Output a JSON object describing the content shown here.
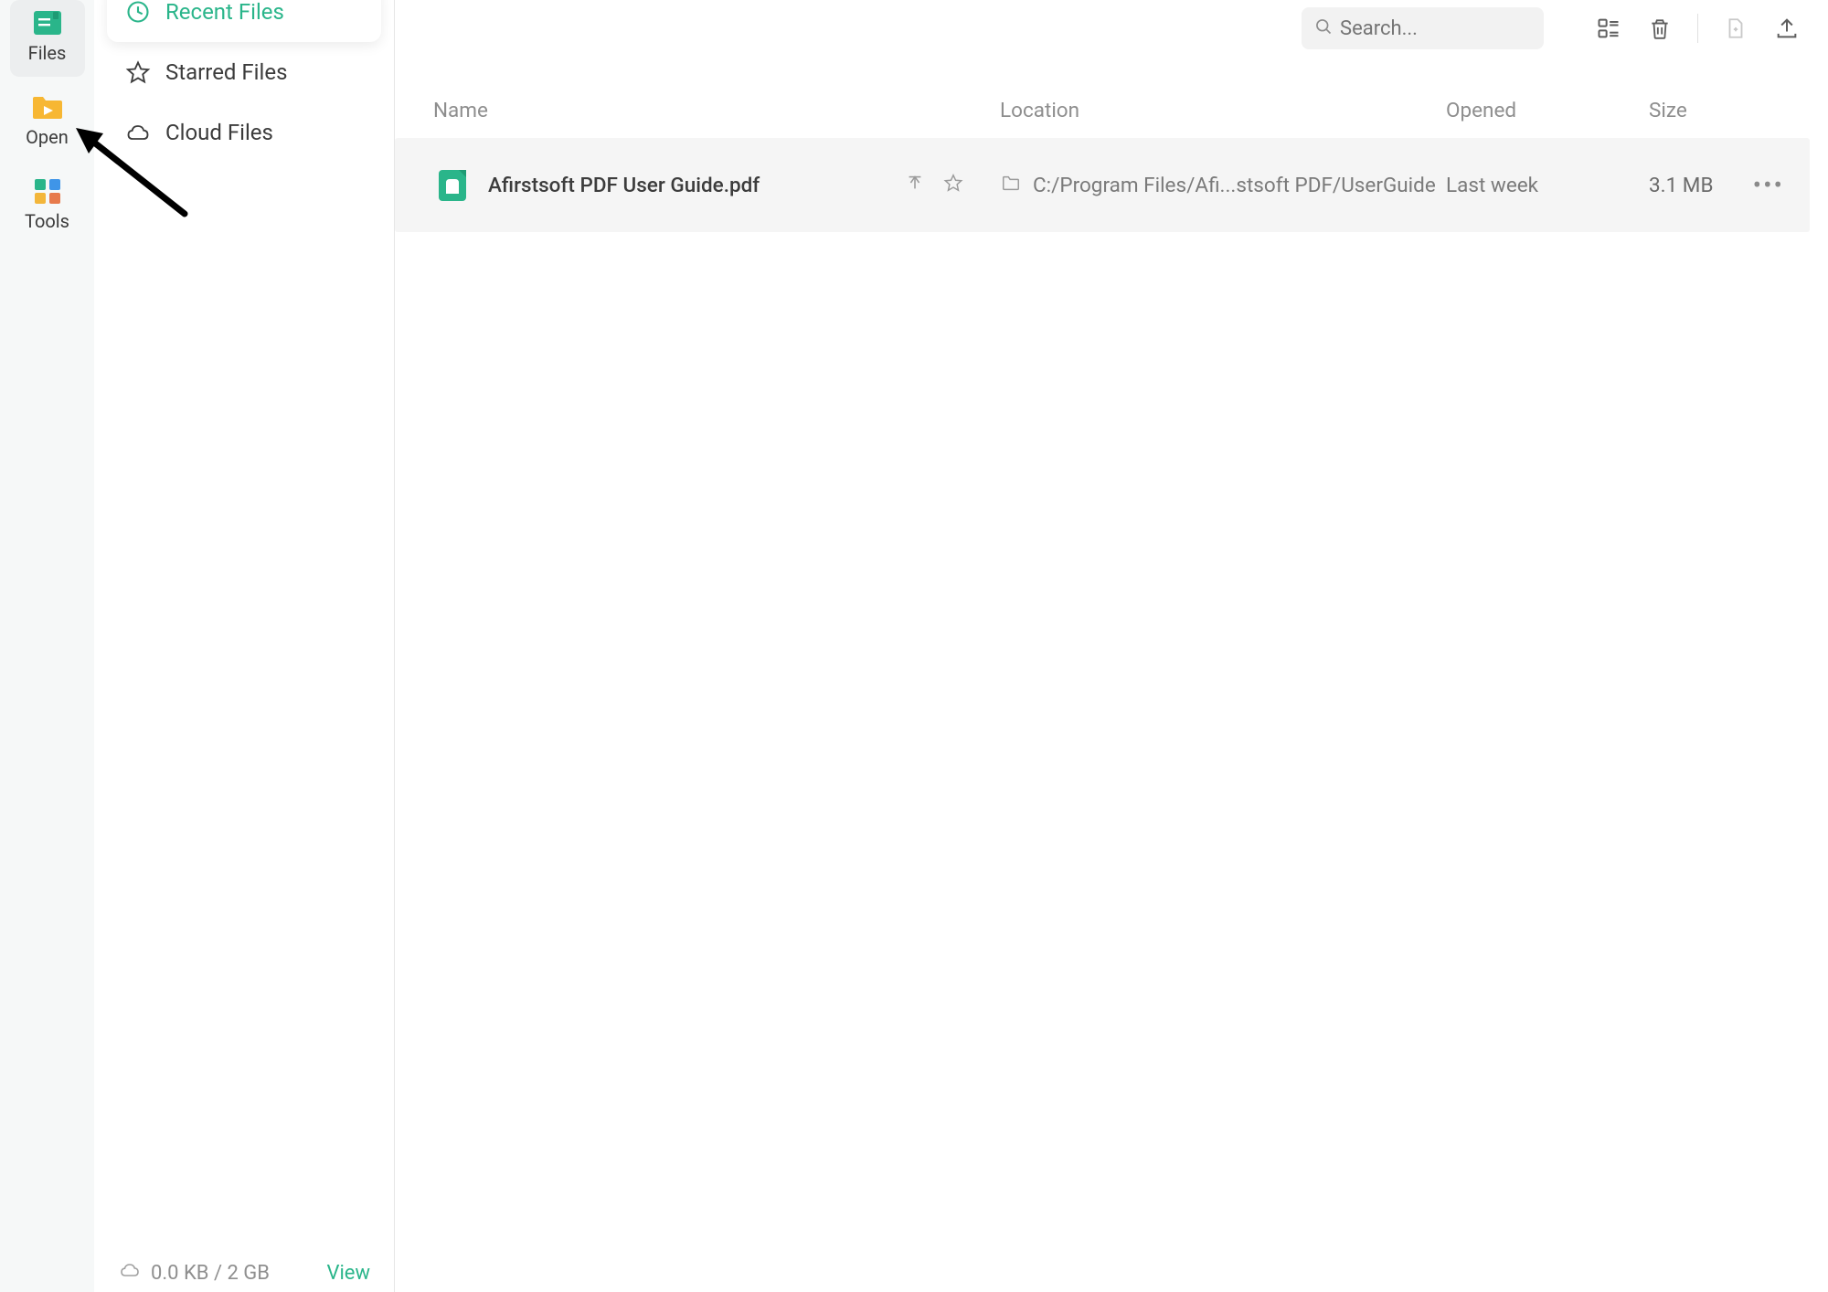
{
  "rail": {
    "files": "Files",
    "open": "Open",
    "tools": "Tools"
  },
  "sidebar": {
    "recent": "Recent Files",
    "starred": "Starred Files",
    "cloud": "Cloud Files",
    "storage": "0.0 KB / 2 GB",
    "view": "View"
  },
  "topbar": {
    "search_placeholder": "Search..."
  },
  "columns": {
    "name": "Name",
    "location": "Location",
    "opened": "Opened",
    "size": "Size"
  },
  "files": [
    {
      "name": "Afirstsoft PDF User Guide.pdf",
      "location": "C:/Program Files/Afi...stsoft PDF/UserGuide",
      "opened": "Last week",
      "size": "3.1 MB"
    }
  ],
  "icons": {
    "search": "search-icon",
    "grid": "grid-view-icon",
    "trash": "trash-icon",
    "newfile": "new-file-icon",
    "upload": "upload-icon",
    "pin": "pin-icon",
    "star": "star-icon",
    "folder": "folder-icon",
    "more": "more-icon",
    "clock": "clock-icon",
    "cloud": "cloud-icon"
  }
}
